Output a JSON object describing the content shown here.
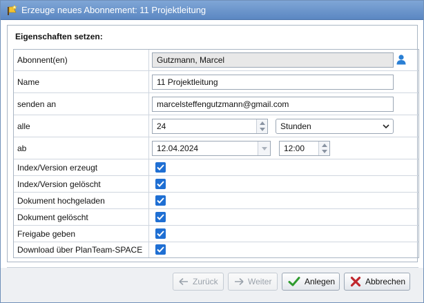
{
  "window": {
    "title": "Erzeuge neues Abonnement: 11 Projektleitung"
  },
  "section": {
    "title": "Eigenschaften setzen:"
  },
  "fields": {
    "abonnent": {
      "label": "Abonnent(en)",
      "value": "Gutzmann, Marcel"
    },
    "name": {
      "label": "Name",
      "value": "11 Projektleitung"
    },
    "senden_an": {
      "label": "senden an",
      "value": "marcelsteffengutzmann@gmail.com"
    },
    "alle": {
      "label": "alle",
      "value": "24",
      "unit": "Stunden"
    },
    "ab": {
      "label": "ab",
      "date": "12.04.2024",
      "time": "12:00"
    }
  },
  "checkboxes": [
    {
      "label": "Index/Version erzeugt",
      "checked": true
    },
    {
      "label": "Index/Version gelöscht",
      "checked": true
    },
    {
      "label": "Dokument hochgeladen",
      "checked": true
    },
    {
      "label": "Dokument gelöscht",
      "checked": true
    },
    {
      "label": "Freigabe geben",
      "checked": true
    },
    {
      "label": "Download über PlanTeam-SPACE",
      "checked": true
    }
  ],
  "buttons": {
    "back": "Zurück",
    "next": "Weiter",
    "create": "Anlegen",
    "cancel": "Abbrechen"
  },
  "colors": {
    "titlebar": "#5b87c2",
    "checkbox": "#1f6fd3",
    "create_check": "#2e9b2e",
    "cancel_x": "#c0262d"
  }
}
